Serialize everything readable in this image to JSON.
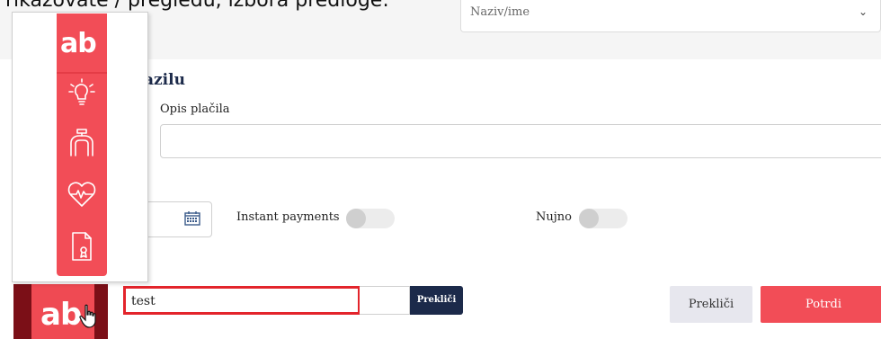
{
  "header": {
    "caption": "rikazovate / pregledu, izbora predloge:",
    "name_select": {
      "value": "Naziv/ime"
    }
  },
  "section": {
    "title": "azilu",
    "description_label": "Opis plačila"
  },
  "toggles": {
    "instant_label": "Instant payments",
    "urgent_label": "Nujno"
  },
  "search": {
    "value": "test",
    "cancel_label": "Prekliči"
  },
  "footer": {
    "cancel_label": "Prekliči",
    "confirm_label": "Potrdi"
  },
  "brand": {
    "logo_text": "ab",
    "accent": "#f24d57",
    "dark_accent": "#7b0f17",
    "navy": "#1c2a4a"
  },
  "panel": {
    "icons": [
      "lightbulb-icon",
      "pipe-icon",
      "heart-pulse-icon",
      "certificate-icon"
    ]
  }
}
